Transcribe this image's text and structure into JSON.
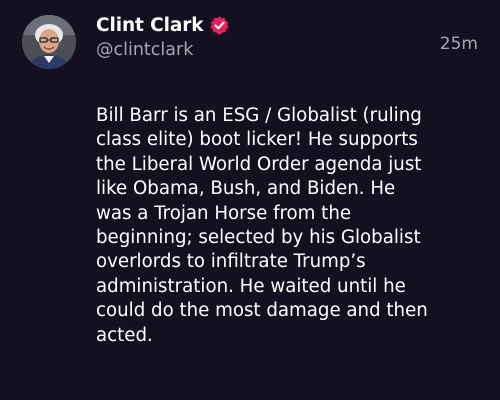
{
  "post": {
    "author": {
      "display_name": "Clint Clark",
      "handle": "@clintclark",
      "verified_icon": "verified-badge-icon",
      "verified_color": "#e0245e"
    },
    "timestamp": "25m",
    "body": "Bill Barr is an ESG / Globalist (ruling\nclass elite) boot licker! He supports\nthe Liberal World Order agenda just\nlike Obama, Bush, and Biden. He\nwas a Trojan Horse from the\nbeginning; selected by his Globalist\noverlords to infiltrate Trump’s\nadministration. He waited until he\ncould do the most damage and then\nacted."
  },
  "theme": {
    "background": "#14101f",
    "text_primary": "#ffffff",
    "text_secondary": "#a9a6b3"
  }
}
